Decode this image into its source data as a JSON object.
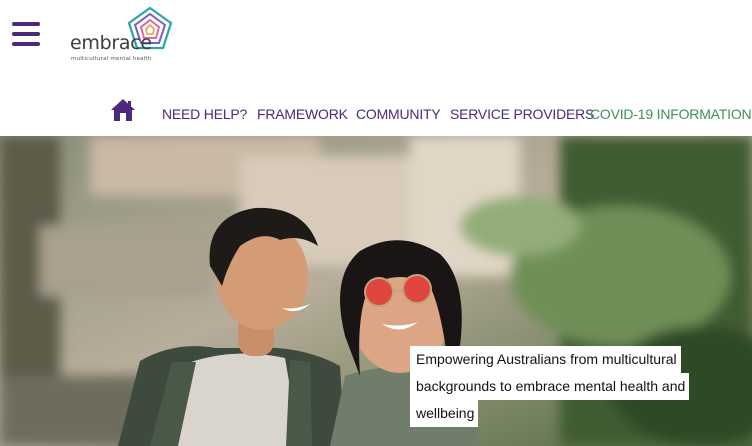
{
  "header": {
    "menu_icon": "hamburger-menu-icon",
    "logo": {
      "wordmark": "embrace",
      "tagline": "multicultural mental health",
      "icon": "pentagon-spiral-logo-icon"
    }
  },
  "nav": {
    "home_icon": "home-icon",
    "items": [
      {
        "label": "NEED HELP?"
      },
      {
        "label": "FRAMEWORK"
      },
      {
        "label": "COMMUNITY"
      },
      {
        "label": "SERVICE PROVIDERS"
      },
      {
        "label": "COVID-19 INFORMATION"
      }
    ]
  },
  "hero": {
    "caption_lines": [
      "Empowering Australians from multicultural",
      "backgrounds to embrace mental health and",
      "wellbeing"
    ]
  },
  "colors": {
    "brand_purple": "#4b2a7b",
    "covid_green": "#3f8f5a",
    "logo_teal": "#2aa6a6",
    "logo_pink": "#d86aa8"
  }
}
